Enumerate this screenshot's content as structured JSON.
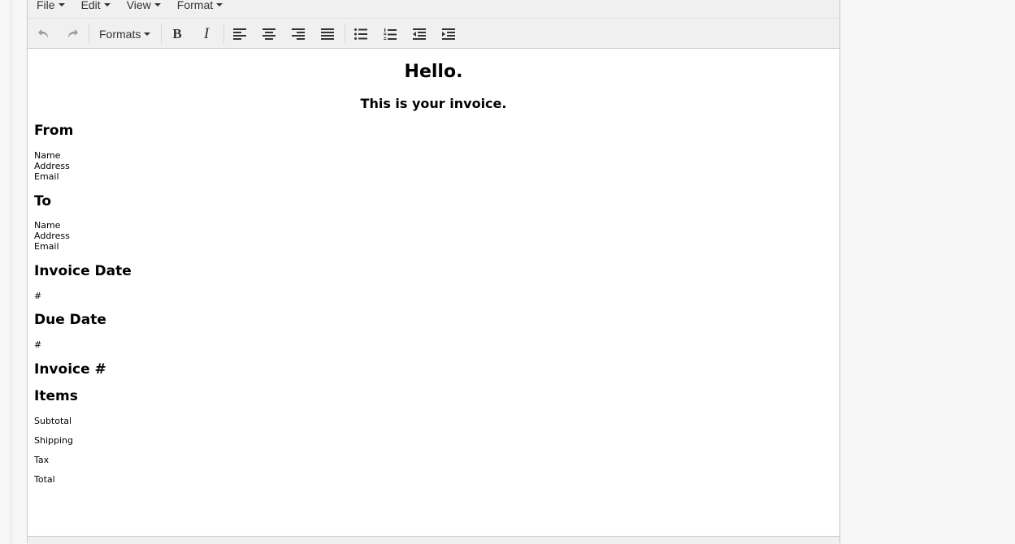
{
  "menubar": {
    "items": [
      "File",
      "Edit",
      "View",
      "Format"
    ]
  },
  "toolbar": {
    "formats_label": "Formats",
    "buttons": [
      "undo-icon",
      "redo-icon",
      "bold-icon",
      "italic-icon",
      "align-left-icon",
      "align-center-icon",
      "align-right-icon",
      "align-justify-icon",
      "bullet-list-icon",
      "numbered-list-icon",
      "outdent-icon",
      "indent-icon"
    ],
    "bold_glyph": "B",
    "italic_glyph": "I"
  },
  "document": {
    "title": "Hello.",
    "subtitle": "This is your invoice.",
    "from": {
      "heading": "From",
      "lines": [
        "Name",
        "Address",
        "Email"
      ]
    },
    "to": {
      "heading": "To",
      "lines": [
        "Name",
        "Address",
        "Email"
      ]
    },
    "invoice_date": {
      "heading": "Invoice Date",
      "value": "#"
    },
    "due_date": {
      "heading": "Due Date",
      "value": "#"
    },
    "invoice_number": {
      "heading": "Invoice #"
    },
    "items": {
      "heading": "Items",
      "rows": [
        "Subtotal",
        "Shipping",
        "Tax",
        "Total"
      ]
    }
  },
  "colors": {
    "toolbar_bg": "#f0f0f0",
    "border": "#c8c8c8",
    "icon": "#333333",
    "disabled_icon": "#888888"
  }
}
